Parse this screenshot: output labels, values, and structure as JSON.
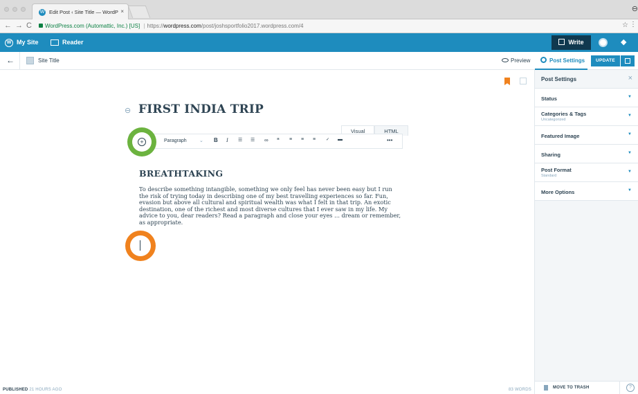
{
  "browser": {
    "tab_title": "Edit Post ‹ Site Title — WordP",
    "tab_close": "×",
    "url_secure_label": "WordPress.com (Automattic, Inc.) [US]",
    "url_prefix": "https://",
    "url_host": "wordpress.com",
    "url_path": "/post/joshsportfolio2017.wordpress.com/4"
  },
  "masterbar": {
    "my_site": "My Site",
    "reader": "Reader",
    "write": "Write"
  },
  "editor_bar": {
    "site_title": "Site Title",
    "preview": "Preview",
    "post_settings": "Post Settings",
    "update": "UPDATE"
  },
  "editor": {
    "title": "FIRST INDIA TRIP",
    "mode_tabs": [
      "Visual",
      "HTML"
    ],
    "format_select": "Paragraph",
    "heading": "BREATHTAKING",
    "paragraph": "To describe something intangible, something we only feel has never been easy but I run the risk of trying today in describing one of my best travelling experiences so far. Fun, evasion but above all cultural and spiritual wealth was what I felt in that trip. An exotic destination, one of the richest and most diverse cultures that I ever saw in my life. My advice to you, dear readers? Read a paragraph and close your eyes ... dream or remember, as appropriate."
  },
  "status": {
    "published_label": "PUBLISHED",
    "published_time": "21 HOURS AGO",
    "word_count": "83 WORDS"
  },
  "sidebar": {
    "header": "Post Settings",
    "rows": [
      {
        "label": "Status",
        "sub": ""
      },
      {
        "label": "Categories & Tags",
        "sub": "Uncategorized"
      },
      {
        "label": "Featured Image",
        "sub": ""
      },
      {
        "label": "Sharing",
        "sub": ""
      },
      {
        "label": "Post Format",
        "sub": "Standard"
      },
      {
        "label": "More Options",
        "sub": ""
      }
    ],
    "trash": "MOVE TO TRASH"
  },
  "colors": {
    "accent": "#1e8cbe",
    "highlight_green": "#6cb33f",
    "highlight_orange": "#f0821e"
  }
}
